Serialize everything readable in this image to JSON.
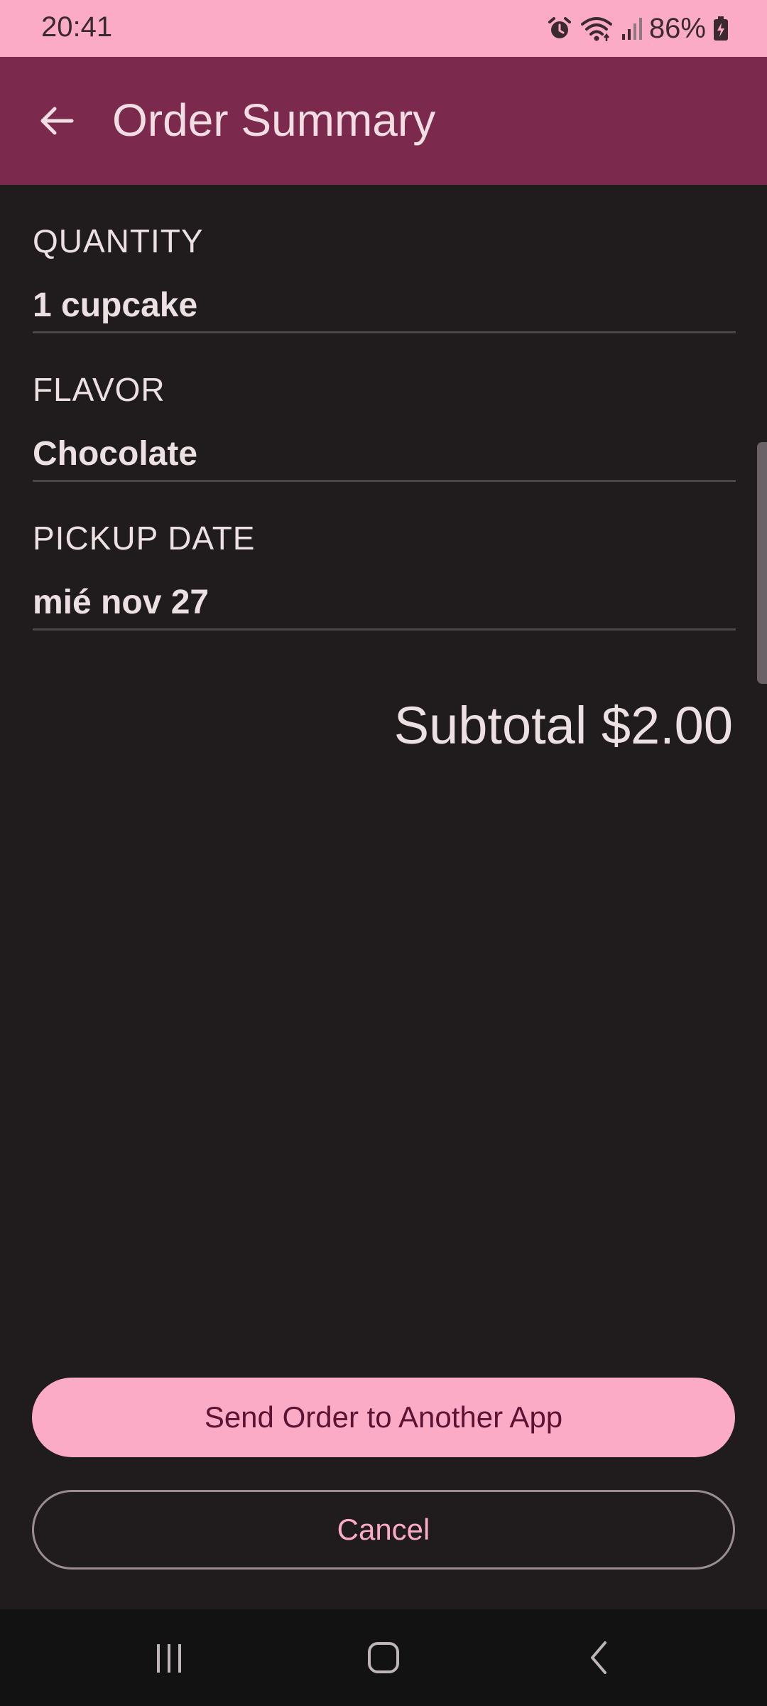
{
  "status_bar": {
    "time": "20:41",
    "battery_percent": "86%",
    "icons": [
      "alarm-icon",
      "wifi-icon",
      "signal-icon",
      "battery-charging-icon"
    ]
  },
  "app_bar": {
    "title": "Order Summary",
    "back_icon": "arrow-back-icon"
  },
  "summary": {
    "fields": [
      {
        "label": "QUANTITY",
        "value": "1 cupcake"
      },
      {
        "label": "FLAVOR",
        "value": "Chocolate"
      },
      {
        "label": "PICKUP DATE",
        "value": "mié nov 27"
      }
    ],
    "subtotal": "Subtotal $2.00"
  },
  "actions": {
    "send_label": "Send Order to Another App",
    "cancel_label": "Cancel"
  },
  "nav_bar": {
    "icons": [
      "recents-icon",
      "home-icon",
      "back-nav-icon"
    ]
  },
  "colors": {
    "status_bar_bg": "#fbabc6",
    "app_bar_bg": "#7b2a4e",
    "background": "#201b1c",
    "primary_button_bg": "#fbabc6",
    "primary_button_text": "#5c1233",
    "outline_button_text": "#fbabc6",
    "text": "#ece0e3"
  }
}
